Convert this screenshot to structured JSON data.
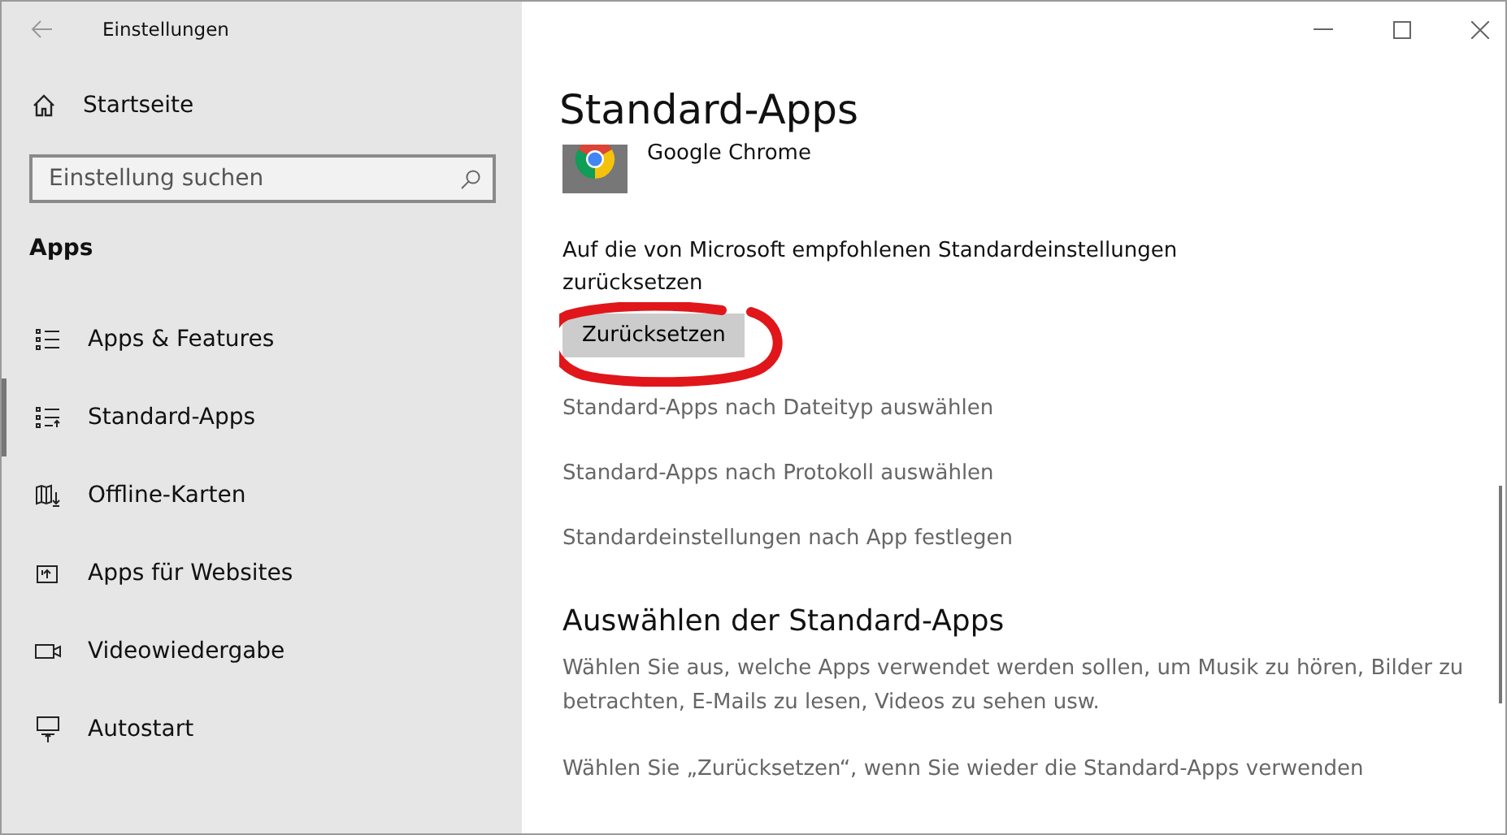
{
  "window": {
    "title": "Einstellungen"
  },
  "sidebar": {
    "home": "Startseite",
    "search": {
      "placeholder": "Einstellung suchen"
    },
    "section": "Apps",
    "items": [
      {
        "label": "Apps & Features",
        "selected": false
      },
      {
        "label": "Standard-Apps",
        "selected": true
      },
      {
        "label": "Offline-Karten",
        "selected": false
      },
      {
        "label": "Apps für Websites",
        "selected": false
      },
      {
        "label": "Videowiedergabe",
        "selected": false
      },
      {
        "label": "Autostart",
        "selected": false
      }
    ]
  },
  "content": {
    "title": "Standard-Apps",
    "app": {
      "name": "Google Chrome"
    },
    "reset_text": "Auf die von Microsoft empfohlenen Standardeinstellungen zurücksetzen",
    "reset_button": "Zurücksetzen",
    "links": [
      "Standard-Apps nach Dateityp auswählen",
      "Standard-Apps nach Protokoll auswählen",
      "Standardeinstellungen nach App festlegen"
    ],
    "section_title": "Auswählen der Standard-Apps",
    "paragraphs": [
      "Wählen Sie aus, welche Apps verwendet werden sollen, um Musik zu hören, Bilder zu betrachten, E-Mails zu lesen, Videos zu sehen usw.",
      "Wählen Sie „Zurücksetzen“, wenn Sie wieder die Standard-Apps verwenden"
    ]
  }
}
